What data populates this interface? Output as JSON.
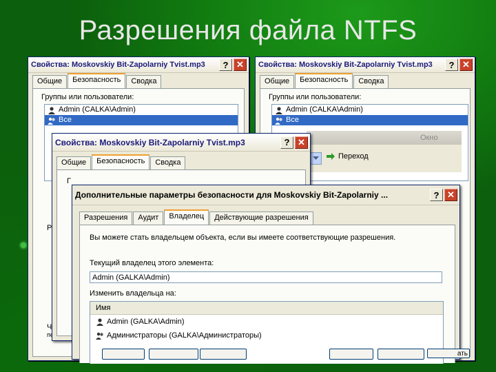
{
  "slide": {
    "title": "Разрешения файла NTFS"
  },
  "colors": {
    "titlebar_text": "#1a1a7a",
    "selection": "#316ac5",
    "close_button": "#c8422a"
  },
  "props_window": {
    "title": "Свойства: Moskovskiy Bit-Zapolarniy Tvist.mp3",
    "help": "?",
    "close": "✕",
    "tabs": [
      "Общие",
      "Безопасность",
      "Сводка"
    ],
    "groups_label": "Группы или пользователи:",
    "users": [
      "Admin (CALKA\\Admin)",
      "Все"
    ],
    "partial_left": [
      "Ра",
      "Чт",
      "пер"
    ]
  },
  "props_window_right": {
    "title": "Свойства: Moskovskiy Bit-Zapolarniy Tvist.mp3",
    "tabs": [
      "Общие",
      "Безопасность",
      "Сводка"
    ],
    "groups_label": "Группы или пользователи:",
    "users": [
      "Admin (CALKA\\Admin)",
      "Все"
    ],
    "bg_window_label": "Окно"
  },
  "props_window_mid": {
    "title": "Свойства: Moskovskiy Bit-Zapolarniy Tvist.mp3",
    "tabs": [
      "Общие",
      "Безопасность",
      "Сводка"
    ],
    "go_button": "Переход",
    "partial_label": "Г"
  },
  "advanced": {
    "title": "Дополнительные параметры безопасности для Moskovskiy Bit-Zapolarniy ...",
    "tabs": [
      "Разрешения",
      "Аудит",
      "Владелец",
      "Действующие разрешения"
    ],
    "selected_tab": "Владелец",
    "info": "Вы можете стать владельцем объекта, если вы имеете соответствующие разрешения.",
    "current_owner_label": "Текущий владелец этого элемента:",
    "current_owner": "Admin (GALKA\\Admin)",
    "change_owner_label": "Изменить владельца на:",
    "column_name": "Имя",
    "owners": [
      "Admin (GALKA\\Admin)",
      "Администраторы (GALKA\\Администраторы)"
    ],
    "partial_button": "ать"
  }
}
